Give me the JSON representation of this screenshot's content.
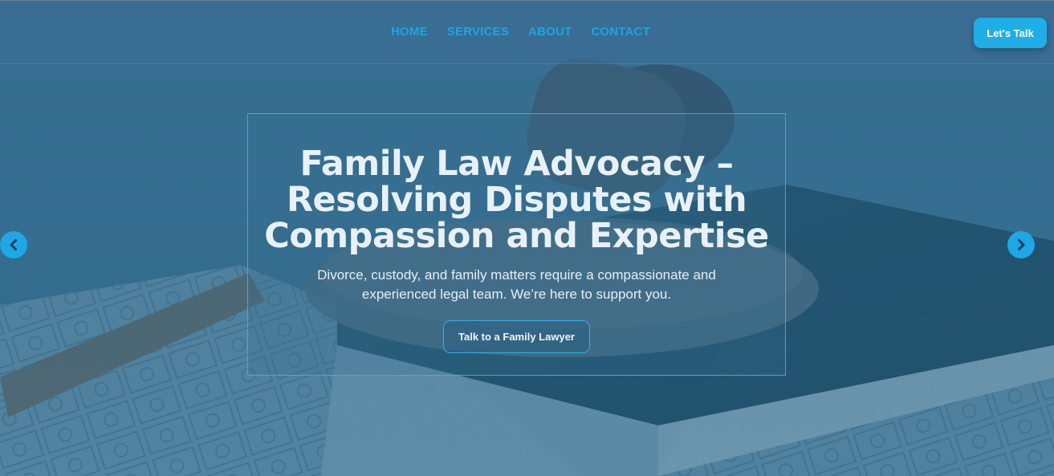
{
  "nav": {
    "items": [
      "HOME",
      "SERVICES",
      "ABOUT",
      "CONTACT"
    ],
    "cta_label": "Let's Talk"
  },
  "hero": {
    "title": "Family Law Advocacy – Resolving Disputes with Compassion and Expertise",
    "subtitle": "Divorce, custody, and family matters require a compassionate and experienced legal team. We’re here to support you.",
    "button_label": "Talk to a Family Lawyer"
  },
  "icons": {
    "prev": "chevron-left-icon",
    "next": "chevron-right-icon"
  },
  "colors": {
    "accent": "#1FAEE8",
    "overlay": "#2F5F7C",
    "text_light": "#E8F1F8"
  }
}
